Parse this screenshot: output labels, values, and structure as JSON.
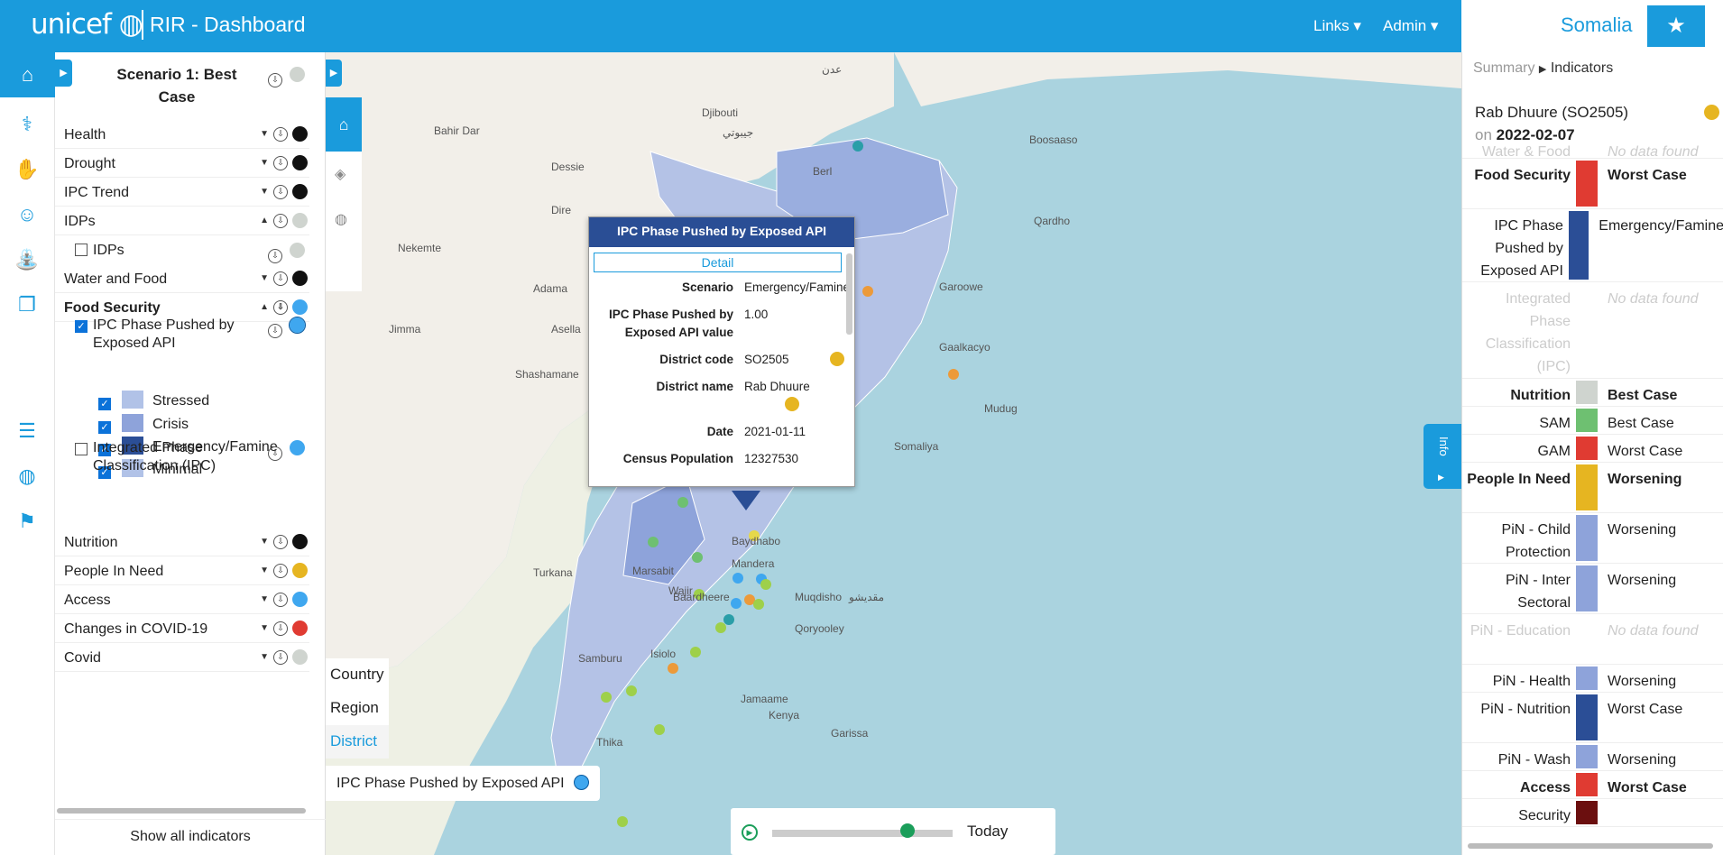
{
  "header": {
    "logo": "unicef",
    "title": "RIR - Dashboard",
    "links": "Links",
    "admin": "Admin",
    "country": "Somalia"
  },
  "sidebar": {
    "scenario_title": "Scenario 1: Best Case",
    "categories": [
      {
        "label": "Health",
        "dot": "#111"
      },
      {
        "label": "Drought",
        "dot": "#111"
      },
      {
        "label": "IPC Trend",
        "dot": "#111"
      },
      {
        "label": "IDPs",
        "dot": "#cfd4cf"
      },
      {
        "label": "Water and Food",
        "dot": "#111"
      },
      {
        "label": "Food Security",
        "dot": "#3fa7ef"
      },
      {
        "label": "Nutrition",
        "dot": "#111"
      },
      {
        "label": "People In Need",
        "dot": "#e6b521"
      },
      {
        "label": "Access",
        "dot": "#3fa7ef"
      },
      {
        "label": "Changes in COVID-19",
        "dot": "#e03b32"
      },
      {
        "label": "Covid",
        "dot": "#cfd4cf"
      }
    ],
    "idps_sub": "IDPs",
    "ipc_pushed": "IPC Phase Pushed by Exposed API",
    "ipc_pushed_lines": [
      "IPC Phase Pushed by",
      "Exposed API"
    ],
    "classes": [
      {
        "label": "Stressed",
        "color": "#b1c2e7"
      },
      {
        "label": "Crisis",
        "color": "#8ea3da"
      },
      {
        "label": "Emergency/Famine",
        "color": "#2b4e96"
      },
      {
        "label": "Minimal",
        "color": "#b1c2e7"
      }
    ],
    "ipc_lines": [
      "Integrated Phase",
      "Classification (IPC)"
    ],
    "show_all": "Show all indicators"
  },
  "map": {
    "levels": [
      "Country",
      "Region",
      "District"
    ],
    "legend": "IPC Phase Pushed by Exposed API",
    "today": "Today",
    "info": "Info",
    "labels": [
      "Djibouti",
      "جيبوتي",
      "Berl",
      "Boosaaso",
      "Qardho",
      "Garoowe",
      "Gaalkacyo",
      "Mudug",
      "Baydhabo",
      "Baardheere",
      "Muqdisho",
      "مقديشو",
      "Qoryooley",
      "Jamaame",
      "Kenya",
      "Garissa",
      "Mandera",
      "Marsabit",
      "Wajir",
      "Isiolo",
      "Samburu",
      "Turkana",
      "Thika",
      "Adama",
      "Asella",
      "Dessie",
      "Dire",
      "Bahir Dar",
      "Nekemte",
      "Jimma",
      "Shashamane",
      "Somaliya",
      "عدن"
    ]
  },
  "popup": {
    "title": "IPC Phase Pushed by Exposed API",
    "detail": "Detail",
    "rows": [
      {
        "k": "Scenario",
        "v": "Emergency/Famine"
      },
      {
        "k": "IPC Phase Pushed by Exposed API value",
        "v": "1.00"
      },
      {
        "k": "District code",
        "v": "SO2505",
        "dot": "#e6b521"
      },
      {
        "k": "District name",
        "v": "Rab Dhuure",
        "dot": "#e6b521"
      },
      {
        "k": "Date",
        "v": "2021-01-11"
      },
      {
        "k": "Census Population",
        "v": "12327530"
      }
    ]
  },
  "right": {
    "crumb_summary": "Summary",
    "crumb_indicators": "Indicators",
    "district": "Rab Dhuure (SO2505)",
    "on": "on",
    "date": "2022-02-07",
    "dot": "#e6b521",
    "indicators": [
      {
        "k": "Water & Food",
        "v": "No data found",
        "faded": true,
        "h": 26
      },
      {
        "k": "Food Security",
        "v": "Worst Case",
        "c": "#e03b32",
        "bold": true,
        "h": 56
      },
      {
        "k": "IPC Phase Pushed by Exposed API",
        "v": "Emergency/Famine",
        "c": "#2b4e96",
        "h": 81
      },
      {
        "k": "Integrated Phase Classification (IPC)",
        "v": "No data found",
        "faded": true,
        "h": 107
      },
      {
        "k": "Nutrition",
        "v": "Best Case",
        "c": "#cfd4cf",
        "bold": true,
        "h": 31
      },
      {
        "k": "SAM",
        "v": "Best Case",
        "c": "#6ec071",
        "h": 31
      },
      {
        "k": "GAM",
        "v": "Worst Case",
        "c": "#e03b32",
        "h": 31
      },
      {
        "k": "People In Need",
        "v": "Worsening",
        "c": "#e6b521",
        "bold": true,
        "h": 56
      },
      {
        "k": "PiN - Child Protection",
        "v": "Worsening",
        "c": "#8ea3da",
        "h": 56
      },
      {
        "k": "PiN - Inter Sectoral",
        "v": "Worsening",
        "c": "#8ea3da",
        "h": 56
      },
      {
        "k": "PiN - Education",
        "v": "No data found",
        "faded": true,
        "h": 56
      },
      {
        "k": "PiN - Health",
        "v": "Worsening",
        "c": "#8ea3da",
        "h": 31
      },
      {
        "k": "PiN - Nutrition",
        "v": "Worst Case",
        "c": "#2b4e96",
        "h": 56
      },
      {
        "k": "PiN - Wash",
        "v": "Worsening",
        "c": "#8ea3da",
        "h": 31
      },
      {
        "k": "Access",
        "v": "Worst Case",
        "c": "#e03b32",
        "bold": true,
        "h": 31
      },
      {
        "k": "Security",
        "v": "",
        "c": "#6b0f0f",
        "h": 31
      }
    ]
  },
  "colors": {
    "brand": "#1a9bdc",
    "ipc_dark": "#2b4e96"
  }
}
